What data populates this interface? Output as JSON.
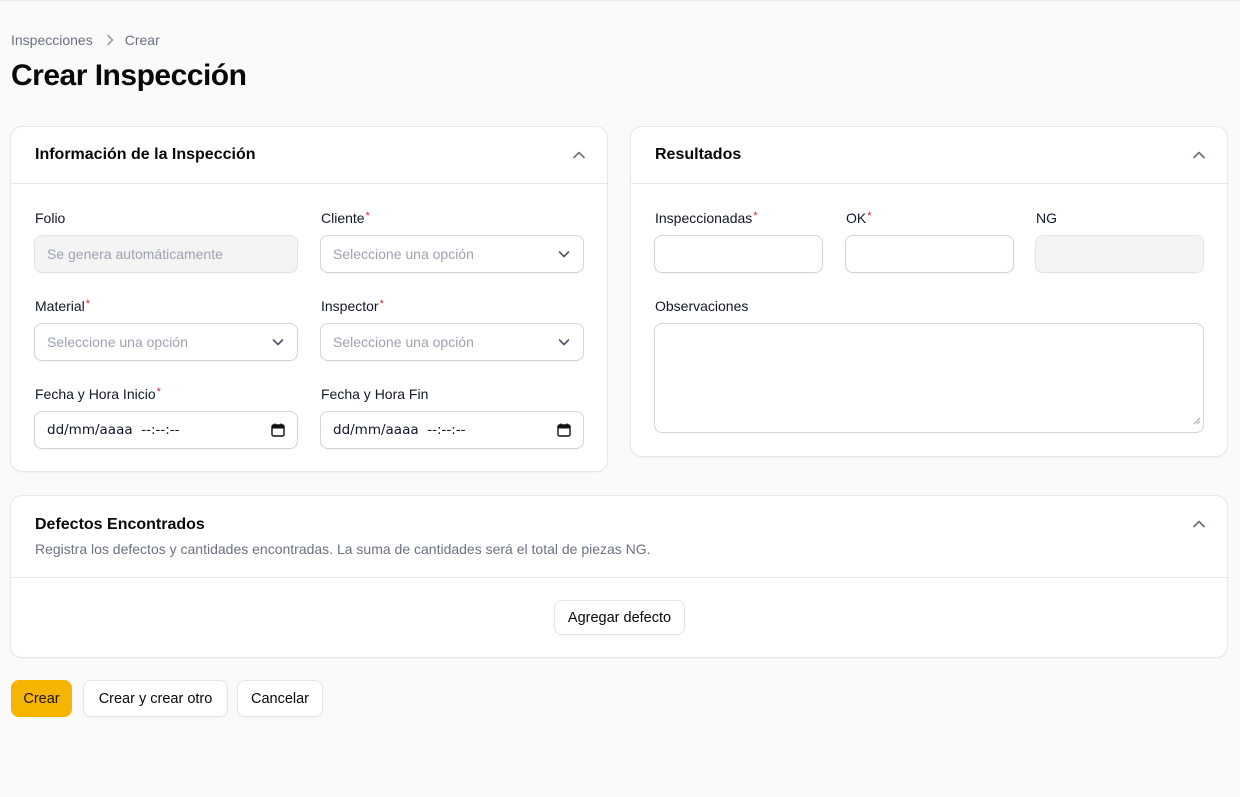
{
  "breadcrumb": {
    "items": [
      "Inspecciones",
      "Crear"
    ]
  },
  "page": {
    "title": "Crear Inspección"
  },
  "info_section": {
    "title": "Información de la Inspección",
    "folio": {
      "label": "Folio",
      "placeholder": "Se genera automáticamente"
    },
    "cliente": {
      "label": "Cliente",
      "placeholder": "Seleccione una opción"
    },
    "material": {
      "label": "Material",
      "placeholder": "Seleccione una opción"
    },
    "inspector": {
      "label": "Inspector",
      "placeholder": "Seleccione una opción"
    },
    "fecha_inicio": {
      "label": "Fecha y Hora Inicio",
      "value": "dd/mm/aaaa  --:--:--"
    },
    "fecha_fin": {
      "label": "Fecha y Hora Fin",
      "value": "dd/mm/aaaa  --:--:--"
    }
  },
  "results_section": {
    "title": "Resultados",
    "inspeccionadas": {
      "label": "Inspeccionadas"
    },
    "ok": {
      "label": "OK"
    },
    "ng": {
      "label": "NG"
    },
    "observaciones": {
      "label": "Observaciones"
    }
  },
  "defects_section": {
    "title": "Defectos Encontrados",
    "description": "Registra los defectos y cantidades encontradas. La suma de cantidades será el total de piezas NG.",
    "add_button": "Agregar defecto"
  },
  "actions": {
    "create": "Crear",
    "create_another": "Crear y crear otro",
    "cancel": "Cancelar"
  },
  "colors": {
    "primary": "#f4b400",
    "required": "#dc2626",
    "border": "#e5e7eb"
  },
  "icons": {
    "breadcrumb_separator": "chevron-right-icon",
    "collapse": "chevron-up-icon",
    "select": "chevron-down-icon",
    "date": "calendar-icon"
  }
}
